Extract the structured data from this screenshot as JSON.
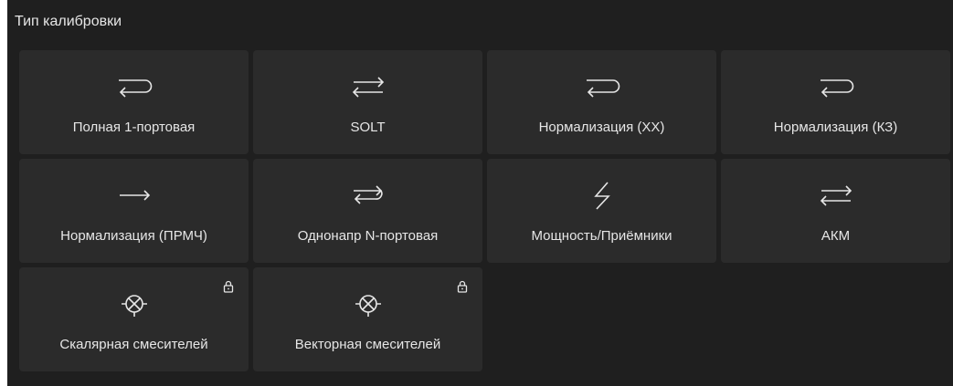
{
  "panel": {
    "title": "Тип калибровки"
  },
  "tiles": [
    {
      "label": "Полная 1-портовая",
      "icon": "reflect-arrow-icon",
      "locked": false
    },
    {
      "label": "SOLT",
      "icon": "two-way-arrows-icon",
      "locked": false
    },
    {
      "label": "Нормализация (XX)",
      "icon": "reflect-arrow-icon",
      "locked": false
    },
    {
      "label": "Нормализация (КЗ)",
      "icon": "reflect-arrow-icon",
      "locked": false
    },
    {
      "label": "Нормализация (ПРМЧ)",
      "icon": "right-arrow-icon",
      "locked": false
    },
    {
      "label": "Однонапр N-портовая",
      "icon": "one-path-arrows-icon",
      "locked": false
    },
    {
      "label": "Мощность/Приёмники",
      "icon": "lightning-icon",
      "locked": false
    },
    {
      "label": "АКМ",
      "icon": "two-way-arrows-icon",
      "locked": false
    },
    {
      "label": "Скалярная смесителей",
      "icon": "mixer-icon",
      "locked": true
    },
    {
      "label": "Векторная смесителей",
      "icon": "mixer-icon",
      "locked": true
    }
  ],
  "colors": {
    "panel_bg": "#1f1f1f",
    "tile_bg": "#2b2b2b",
    "text": "#e6e6e6"
  }
}
